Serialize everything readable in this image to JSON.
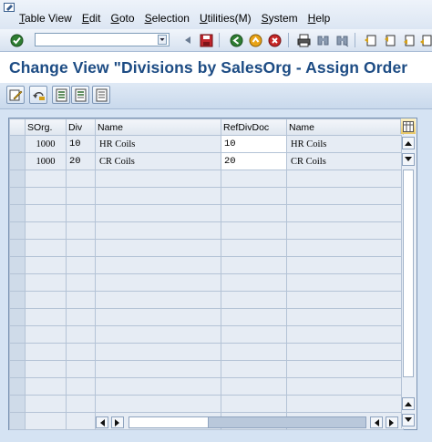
{
  "menubar": {
    "items": [
      {
        "label": "Table View",
        "underline_index": 0
      },
      {
        "label": "Edit",
        "underline_index": 0
      },
      {
        "label": "Goto",
        "underline_index": 0
      },
      {
        "label": "Selection",
        "underline_index": 0
      },
      {
        "label": "Utilities(M)",
        "underline_index": 0
      },
      {
        "label": "System",
        "underline_index": 0
      },
      {
        "label": "Help",
        "underline_index": 0
      }
    ]
  },
  "toolbar": {
    "command_value": "",
    "icons": [
      "enter-icon",
      "back-icon",
      "save-icon",
      "back-arrow-icon",
      "exit-icon",
      "cancel-icon",
      "print-icon",
      "find-icon",
      "find-next-icon",
      "first-page-icon",
      "previous-page-icon",
      "next-page-icon"
    ]
  },
  "page": {
    "title": "Change View \"Divisions by SalesOrg - Assign Order"
  },
  "app_toolbar": {
    "icons": [
      "change-display-icon",
      "undo-change-icon",
      "select-all-icon",
      "select-block-icon",
      "deselect-all-icon"
    ]
  },
  "table": {
    "columns": [
      "SOrg.",
      "Div",
      "Name",
      "RefDivDoc",
      "Name"
    ],
    "rows": [
      {
        "sorg": "1000",
        "div": "10",
        "name": "HR Coils",
        "refdivdoc": "10",
        "refname": "HR Coils"
      },
      {
        "sorg": "1000",
        "div": "20",
        "name": "CR Coils",
        "refdivdoc": "20",
        "refname": "CR Coils"
      }
    ],
    "empty_rows": 15
  },
  "colors": {
    "title": "#1d4c84",
    "background": "#d5e3f3",
    "input_bg": "#ffffff"
  }
}
